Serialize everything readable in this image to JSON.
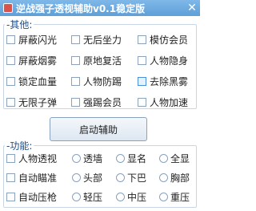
{
  "window": {
    "title": "逆战强子透视辅助v0.1稳定版",
    "close_glyph": "✕"
  },
  "misc_group": {
    "title": "其他",
    "rows": [
      [
        "屏蔽闪光",
        "无后坐力",
        "模仿会员"
      ],
      [
        "屏蔽烟雾",
        "原地复活",
        "人物隐身"
      ],
      [
        "锁定血量",
        "人物防踢",
        "去除黑雾"
      ],
      [
        "无限子弹",
        "强踢会员",
        "人物加速"
      ]
    ]
  },
  "start_button": {
    "label": "启动辅助"
  },
  "func_group": {
    "title": "功能",
    "rows": [
      {
        "checkbox": "人物透视",
        "radios": [
          "透墙",
          "显名",
          "全显"
        ]
      },
      {
        "checkbox": "自动瞄准",
        "radios": [
          "头部",
          "下巴",
          "胸部"
        ]
      },
      {
        "checkbox": "自动压枪",
        "radios": [
          "轻压",
          "中压",
          "重压"
        ]
      }
    ]
  }
}
